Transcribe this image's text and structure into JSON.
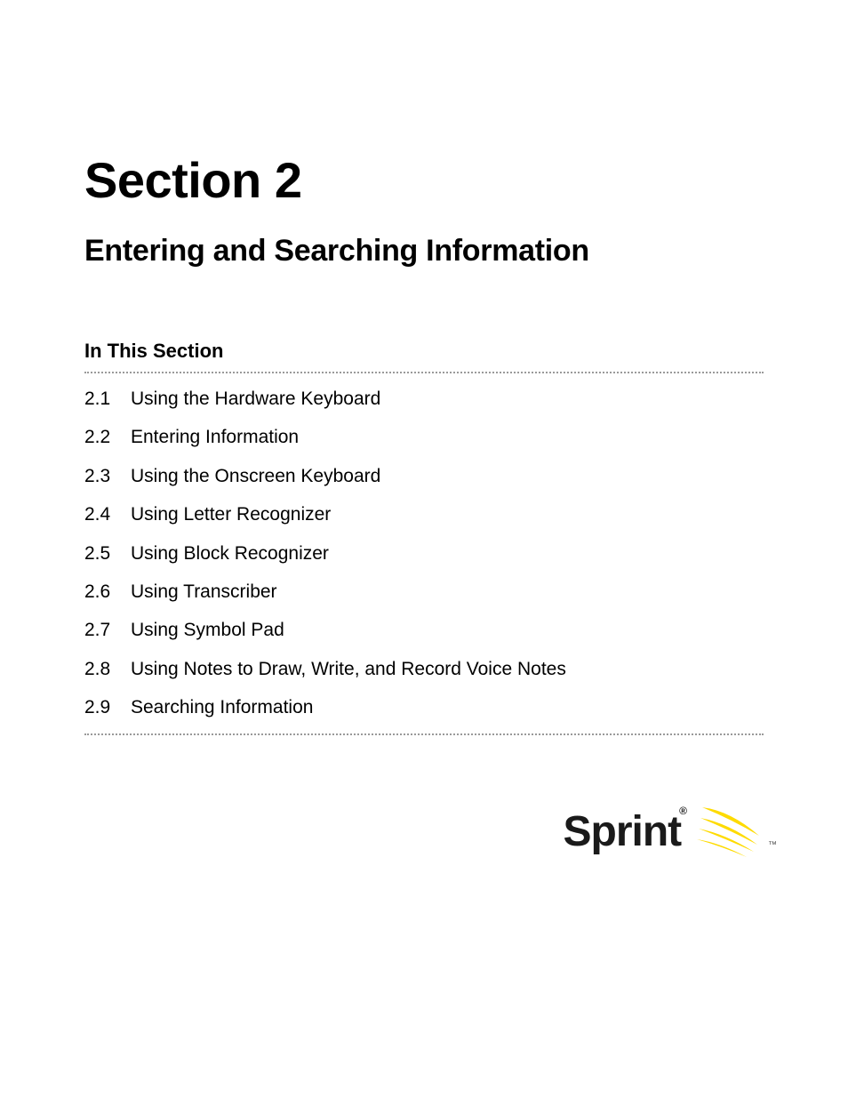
{
  "section": {
    "title": "Section 2",
    "subtitle": "Entering and Searching Information"
  },
  "toc": {
    "header": "In This Section",
    "items": [
      {
        "num": "2.1",
        "label": "Using the Hardware Keyboard"
      },
      {
        "num": "2.2",
        "label": "Entering Information"
      },
      {
        "num": "2.3",
        "label": "Using the Onscreen Keyboard"
      },
      {
        "num": "2.4",
        "label": "Using Letter Recognizer"
      },
      {
        "num": "2.5",
        "label": "Using Block Recognizer"
      },
      {
        "num": "2.6",
        "label": "Using Transcriber"
      },
      {
        "num": "2.7",
        "label": "Using Symbol Pad"
      },
      {
        "num": "2.8",
        "label": "Using Notes to Draw, Write, and Record Voice Notes"
      },
      {
        "num": "2.9",
        "label": "Searching Information"
      }
    ]
  },
  "brand": {
    "name": "Sprint",
    "registered": "®",
    "trademark": "™",
    "accent_color": "#FEDB00"
  }
}
